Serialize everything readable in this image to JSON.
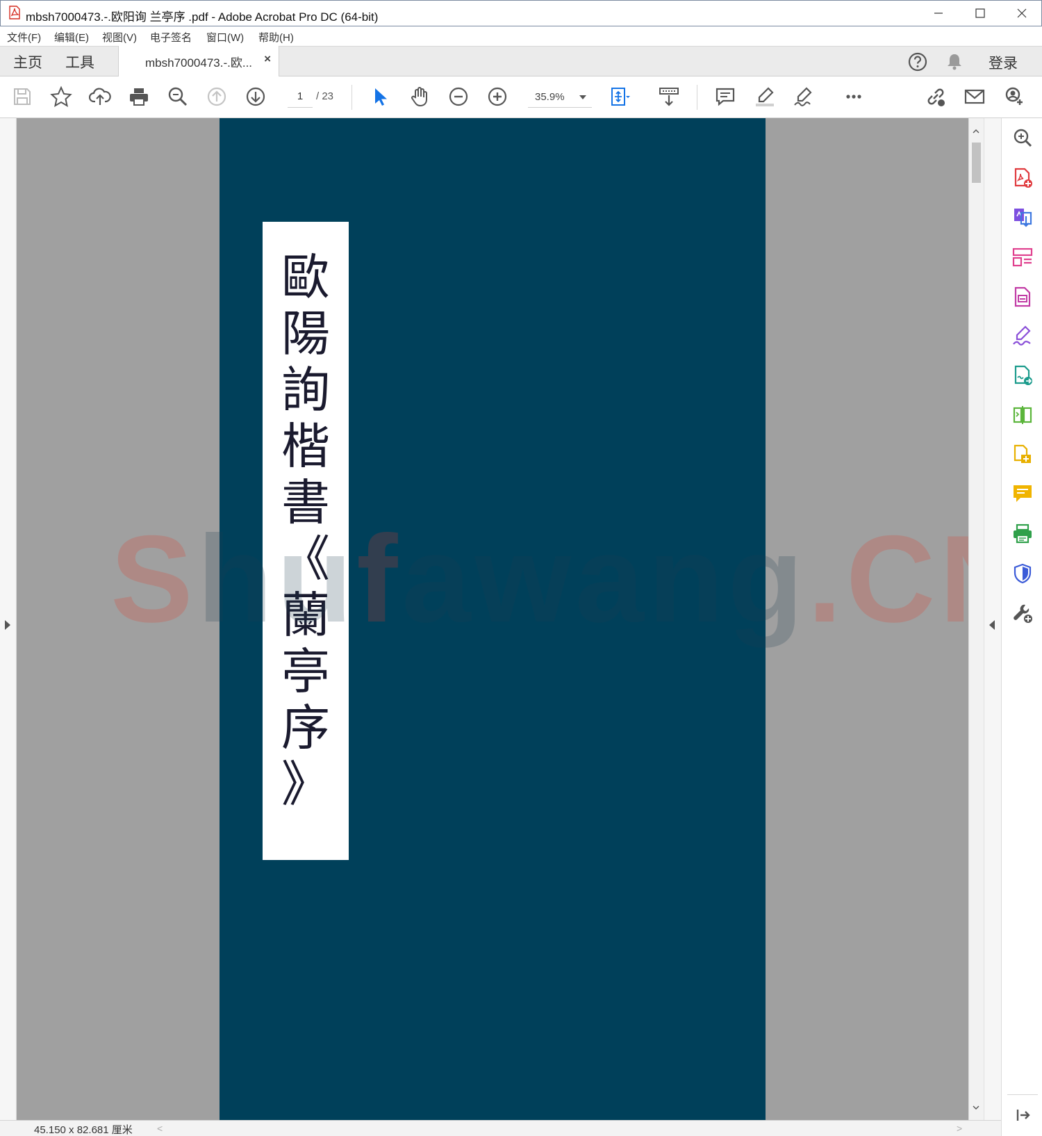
{
  "window": {
    "title": "mbsh7000473.-.欧阳询 兰亭序 .pdf - Adobe Acrobat Pro DC (64-bit)"
  },
  "menu": [
    "文件(F)",
    "编辑(E)",
    "视图(V)",
    "电子签名",
    "窗口(W)",
    "帮助(H)"
  ],
  "tabs": {
    "home": "主页",
    "tools": "工具",
    "document": "mbsh7000473.-.欧...",
    "close": "×",
    "login": "登录"
  },
  "toolbar": {
    "page_current": "1",
    "page_total": "/ 23",
    "zoom": "35.9%"
  },
  "document": {
    "title_vertical": "歐\n陽\n詢\n楷\n書\n《\n蘭\n亭\n序\n》",
    "watermark": "Shufawang.CN",
    "watermark_red_1": "S",
    "watermark_mid_1": "hu",
    "watermark_red_2": "f",
    "watermark_mid_2": "awang",
    "watermark_red_3": ".CN"
  },
  "status": {
    "dimensions": "45.150 x 82.681 厘米",
    "scroll_left": "<",
    "scroll_right": ">"
  },
  "colors": {
    "page_background": "#00405a",
    "canvas_background": "#a0a0a0",
    "accent_blue": "#1473e6",
    "watermark_red": "#e33a2a"
  },
  "icons": {
    "toolbar": [
      "save-icon",
      "bookmark-star-icon",
      "upload-cloud-icon",
      "print-icon",
      "search-zoom-icon",
      "prev-page-icon",
      "next-page-icon",
      "select-arrow-icon",
      "hand-tool-icon",
      "zoom-out-icon",
      "zoom-in-icon",
      "fit-page-icon",
      "scroll-mode-icon",
      "comment-icon",
      "highlight-icon",
      "sign-icon",
      "more-icon",
      "share-link-icon",
      "email-icon",
      "add-user-icon"
    ],
    "right_pane": [
      "enhance-scan-icon",
      "create-pdf-icon",
      "export-pdf-icon",
      "organize-pages-icon",
      "edit-pdf-icon",
      "fill-sign-icon",
      "send-for-signature-icon",
      "compare-files-icon",
      "combine-files-icon",
      "comment-tool-icon",
      "print-production-icon",
      "protect-icon",
      "more-tools-icon"
    ]
  }
}
